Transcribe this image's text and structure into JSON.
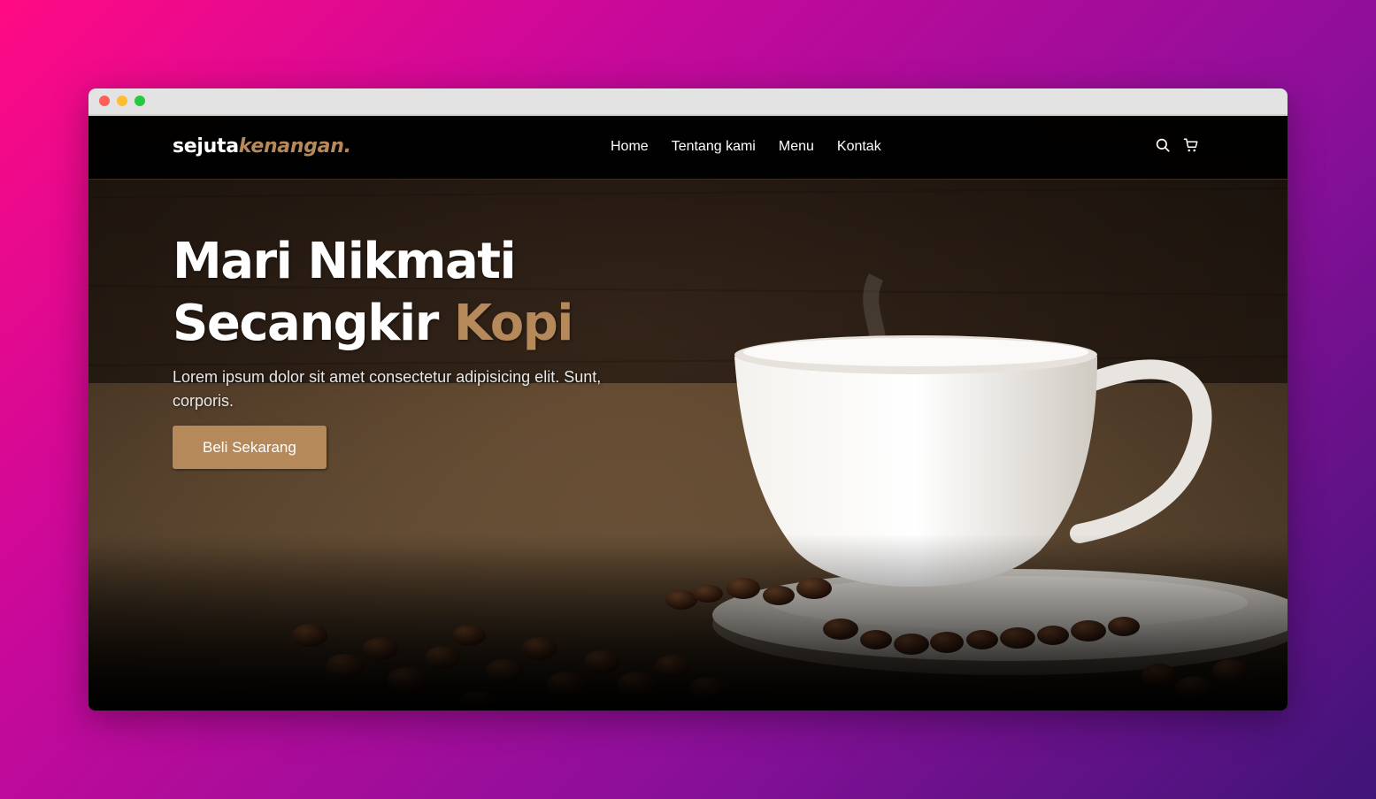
{
  "window": {
    "controls": [
      "close",
      "minimize",
      "maximize"
    ]
  },
  "navbar": {
    "logo_main": "sejuta",
    "logo_accent": "kenangan.",
    "links": [
      "Home",
      "Tentang kami",
      "Menu",
      "Kontak"
    ],
    "icons": [
      "search-icon",
      "shopping-cart-icon"
    ]
  },
  "hero": {
    "title_line1": "Mari Nikmati",
    "title_line2": "Secangkir ",
    "title_accent": "Kopi",
    "description": "Lorem ipsum dolor sit amet consectetur adipisicing elit. Sunt, corporis.",
    "cta_label": "Beli Sekarang"
  },
  "colors": {
    "accent": "#b6895b",
    "navbar_bg": "#000000",
    "text": "#ffffff"
  }
}
